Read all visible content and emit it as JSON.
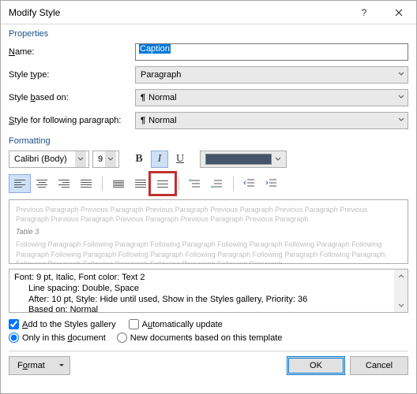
{
  "title": "Modify Style",
  "groups": {
    "properties": "Properties",
    "formatting": "Formatting"
  },
  "fields": {
    "name_label": "Name:",
    "name_value": "Caption",
    "styletype_label": "Style type:",
    "styletype_value": "Paragraph",
    "basedon_label": "Style based on:",
    "basedon_value": "Normal",
    "following_label": "Style for following paragraph:",
    "following_value": "Normal"
  },
  "toolbar": {
    "font": "Calibri (Body)",
    "size": "9",
    "bold": "B",
    "italic": "I",
    "underline": "U",
    "color": "#44546a"
  },
  "preview": {
    "prev": "Previous Paragraph Previous Paragraph Previous Paragraph Previous Paragraph Previous Paragraph Previous Paragraph Previous Paragraph Previous Paragraph Previous Paragraph Previous Paragraph",
    "sample": "Table 3",
    "next": "Following Paragraph Following Paragraph Following Paragraph Following Paragraph Following Paragraph Following Paragraph Following Paragraph Following Paragraph Following Paragraph Following Paragraph Following Paragraph Following Paragraph Following Paragraph Following Paragraph Following Paragraph"
  },
  "description": {
    "l1": "Font: 9 pt, Italic, Font color: Text 2",
    "l2": "Line spacing:  Double, Space",
    "l3": "After:  10 pt, Style: Hide until used, Show in the Styles gallery, Priority: 36",
    "l4": "Based on: Normal"
  },
  "options": {
    "add_gallery": "Add to the Styles gallery",
    "auto_update": "Automatically update",
    "only_doc": "Only in this document",
    "new_docs": "New documents based on this template"
  },
  "buttons": {
    "format": "Format",
    "ok": "OK",
    "cancel": "Cancel"
  }
}
